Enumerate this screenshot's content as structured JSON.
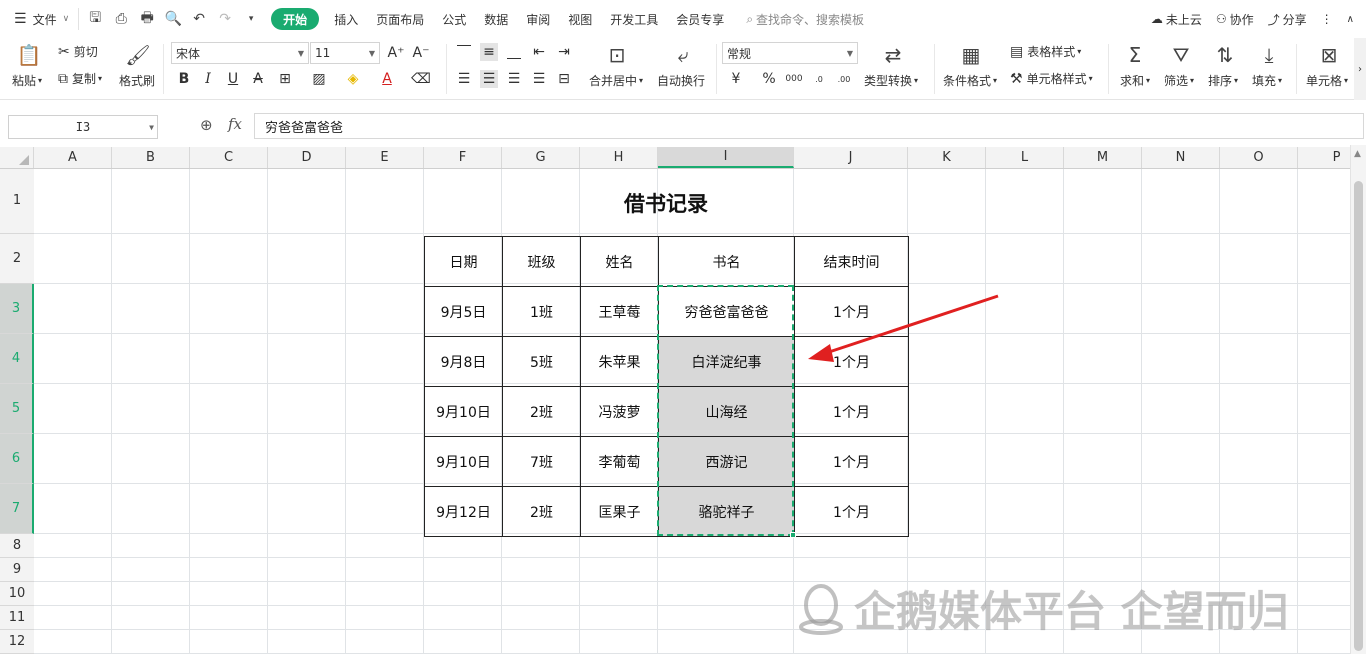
{
  "menubar": {
    "file": "文件",
    "tabs": [
      "开始",
      "插入",
      "页面布局",
      "公式",
      "数据",
      "审阅",
      "视图",
      "开发工具",
      "会员专享"
    ],
    "active_tab": "开始",
    "search_placeholder": "查找命令、搜索模板",
    "cloud": "未上云",
    "collab": "协作",
    "share": "分享"
  },
  "ribbon": {
    "paste": "粘贴",
    "cut": "剪切",
    "copy": "复制",
    "format_painter": "格式刷",
    "font_name": "宋体",
    "font_size": "11",
    "merge_center": "合并居中",
    "wrap_text": "自动换行",
    "number_format": "常规",
    "type_convert": "类型转换",
    "conditional_format": "条件格式",
    "table_style": "表格样式",
    "cell_style": "单元格样式",
    "sum": "求和",
    "filter": "筛选",
    "sort": "排序",
    "fill": "填充",
    "cell": "单元格"
  },
  "formula_bar": {
    "name_box": "I3",
    "fx": "fx",
    "value": "穷爸爸富爸爸"
  },
  "columns": [
    "A",
    "B",
    "C",
    "D",
    "E",
    "F",
    "G",
    "H",
    "I",
    "J",
    "K",
    "L",
    "M",
    "N",
    "O",
    "P"
  ],
  "selected_column": "I",
  "rows": [
    "1",
    "2",
    "3",
    "4",
    "5",
    "6",
    "7",
    "8",
    "9",
    "10",
    "11",
    "12"
  ],
  "selected_rows": [
    "3",
    "4",
    "5",
    "6",
    "7"
  ],
  "sheet": {
    "title": "借书记录",
    "headers": [
      "日期",
      "班级",
      "姓名",
      "书名",
      "结束时间"
    ],
    "records": [
      [
        "9月5日",
        "1班",
        "王草莓",
        "穷爸爸富爸爸",
        "1个月"
      ],
      [
        "9月8日",
        "5班",
        "朱苹果",
        "白洋淀纪事",
        "1个月"
      ],
      [
        "9月10日",
        "2班",
        "冯菠萝",
        "山海经",
        "1个月"
      ],
      [
        "9月10日",
        "7班",
        "李葡萄",
        "西游记",
        "1个月"
      ],
      [
        "9月12日",
        "2班",
        "匡果子",
        "骆驼祥子",
        "1个月"
      ]
    ]
  },
  "watermark": "企鹅媒体平台 企望而归",
  "colors": {
    "accent": "#1aab70",
    "arrow": "#e02020",
    "selection_fill": "#d8d8d8"
  }
}
